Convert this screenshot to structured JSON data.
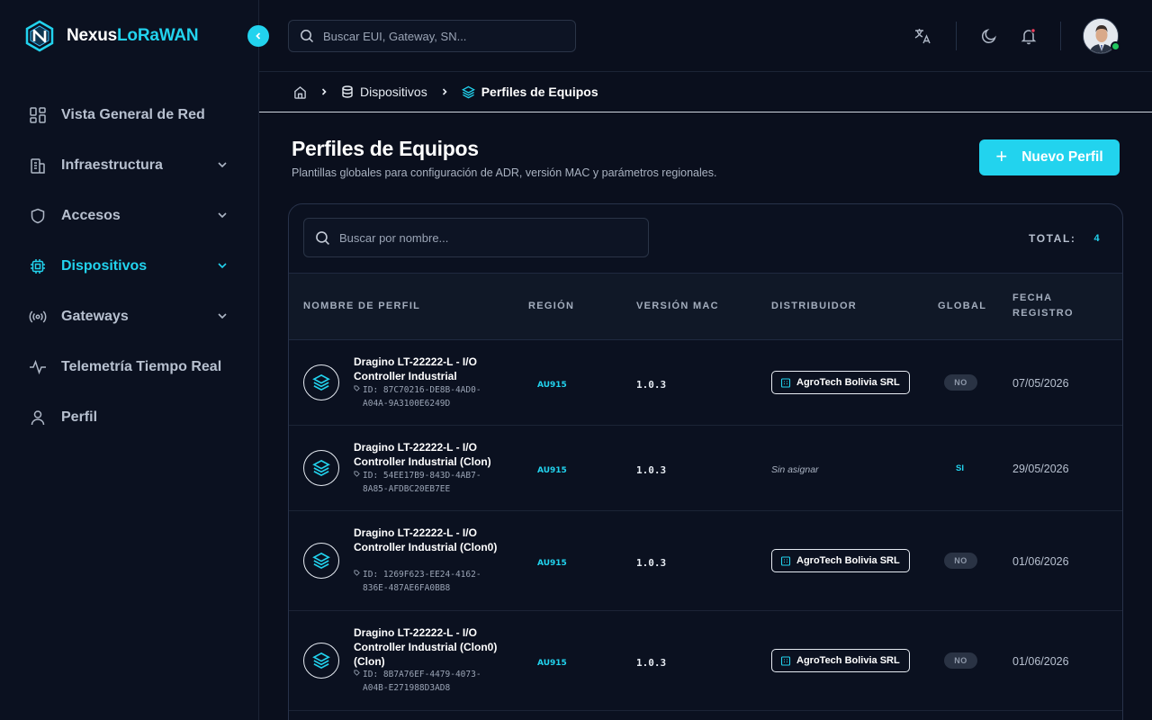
{
  "brand": {
    "name_part1": "Nexus",
    "name_part2": "LoRaWAN"
  },
  "sidebar": {
    "items": [
      {
        "label": "Vista General de Red",
        "icon": "grid-icon",
        "active": false,
        "has_chevron": false
      },
      {
        "label": "Infraestructura",
        "icon": "building-icon",
        "active": false,
        "has_chevron": true
      },
      {
        "label": "Accesos",
        "icon": "shield-icon",
        "active": false,
        "has_chevron": true
      },
      {
        "label": "Dispositivos",
        "icon": "chip-icon",
        "active": true,
        "has_chevron": true
      },
      {
        "label": "Gateways",
        "icon": "radio-icon",
        "active": false,
        "has_chevron": true
      },
      {
        "label": "Telemetría Tiempo Real",
        "icon": "activity-icon",
        "active": false,
        "has_chevron": false
      },
      {
        "label": "Perfil",
        "icon": "user-icon",
        "active": false,
        "has_chevron": false
      }
    ]
  },
  "topbar": {
    "search_placeholder": "Buscar EUI, Gateway, SN...",
    "icons": [
      "translate-icon",
      "moon-icon",
      "bell-icon"
    ],
    "user_status": "online"
  },
  "breadcrumb": {
    "home_icon": "home-icon",
    "items": [
      {
        "label": "Dispositivos",
        "icon": "database-icon"
      },
      {
        "label": "Perfiles de Equipos",
        "icon": "layers-icon"
      }
    ]
  },
  "page": {
    "title": "Perfiles de Equipos",
    "subtitle": "Plantillas globales para configuración de ADR, versión MAC y parámetros regionales.",
    "new_button_label": "Nuevo Perfil"
  },
  "table": {
    "search_placeholder": "Buscar por nombre...",
    "total_label": "TOTAL:",
    "total_value": "4",
    "columns": {
      "name": "NOMBRE DE PERFIL",
      "region": "REGIÓN",
      "mac": "VERSIÓN MAC",
      "distributor": "DISTRIBUIDOR",
      "global": "GLOBAL",
      "date_line1": "FECHA",
      "date_line2": "REGISTRO"
    },
    "rows": [
      {
        "name": "Dragino LT-22222-L - I/O Controller Industrial",
        "id": "ID: 87C70216-DE8B-4AD0-A04A-9A3100E6249D",
        "region": "AU915",
        "mac": "1.0.3",
        "distributor": "AgroTech Bolivia SRL",
        "global": "NO",
        "date": "07/05/2026"
      },
      {
        "name": "Dragino LT-22222-L - I/O Controller Industrial (Clon)",
        "id": "ID: 54EE17B9-843D-4AB7-8A85-AFDBC20EB7EE",
        "region": "AU915",
        "mac": "1.0.3",
        "distributor": "Sin asignar",
        "global": "SI",
        "date": "29/05/2026"
      },
      {
        "name": "Dragino LT-22222-L - I/O Controller Industrial (Clon0)",
        "id": "ID: 1269F623-EE24-4162-836E-487AE6FA0BB8",
        "region": "AU915",
        "mac": "1.0.3",
        "distributor": "AgroTech Bolivia SRL",
        "global": "NO",
        "date": "01/06/2026"
      },
      {
        "name": "Dragino LT-22222-L - I/O Controller Industrial (Clon0) (Clon)",
        "id": "ID: 8B7A76EF-4479-4073-A04B-E271988D3AD8",
        "region": "AU915",
        "mac": "1.0.3",
        "distributor": "AgroTech Bolivia SRL",
        "global": "NO",
        "date": "01/06/2026"
      }
    ]
  },
  "colors": {
    "accent": "#22d3ee",
    "background": "#0a0f1d",
    "online": "#22c55e"
  }
}
